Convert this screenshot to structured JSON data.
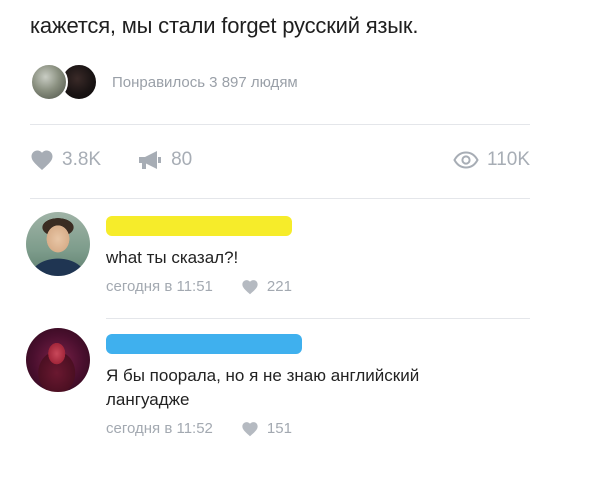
{
  "post": {
    "text": "кажется, мы стали forget русский язык."
  },
  "likes_summary": {
    "text": "Понравилось 3 897 людям"
  },
  "stats": {
    "likes": "3.8K",
    "reposts": "80",
    "views": "110K"
  },
  "comments": [
    {
      "text": "what ты сказал?!",
      "time": "сегодня в 11:51",
      "likes": "221",
      "name_bar_color": "#f6ec2a"
    },
    {
      "text": "Я бы поорала, но я не знаю английский лангуадже",
      "time": "сегодня в 11:52",
      "likes": "151",
      "name_bar_color": "#3fb0ee"
    }
  ],
  "colors": {
    "icon_gray": "#a7adb5",
    "meta_gray": "#a3a9b1",
    "divider": "#e4e6ea"
  }
}
